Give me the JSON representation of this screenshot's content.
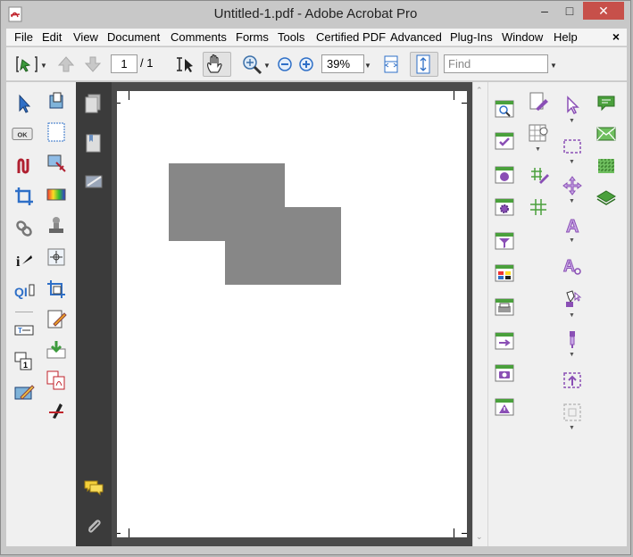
{
  "window": {
    "title": "Untitled-1.pdf - Adobe Acrobat Pro",
    "min_label": "–",
    "max_label": "□",
    "close_label": "✕"
  },
  "menu": {
    "items": [
      "File",
      "Edit",
      "View",
      "Document",
      "Comments",
      "Forms",
      "Tools",
      "Certified PDF",
      "Advanced",
      "Plug-Ins",
      "Window",
      "Help"
    ],
    "close_label": "×"
  },
  "toolbar": {
    "page_number": "1",
    "page_total": "/ 1",
    "zoom": "39%",
    "find_placeholder": "Find"
  },
  "left_tools": {
    "ok_label": "OK"
  },
  "colors": {
    "shape_fill": "#878787",
    "nav_pane_bg": "#3b3b3b",
    "doc_bg": "#4b4b4b",
    "close_button": "#c7504a",
    "accent_purple": "#8a4fb5",
    "accent_green": "#4aa03c",
    "accent_blue": "#2e6fc7"
  },
  "icons": {
    "nav": [
      "pages-icon",
      "bookmarks-icon",
      "signatures-icon",
      "comments-icon",
      "attachments-icon"
    ]
  }
}
